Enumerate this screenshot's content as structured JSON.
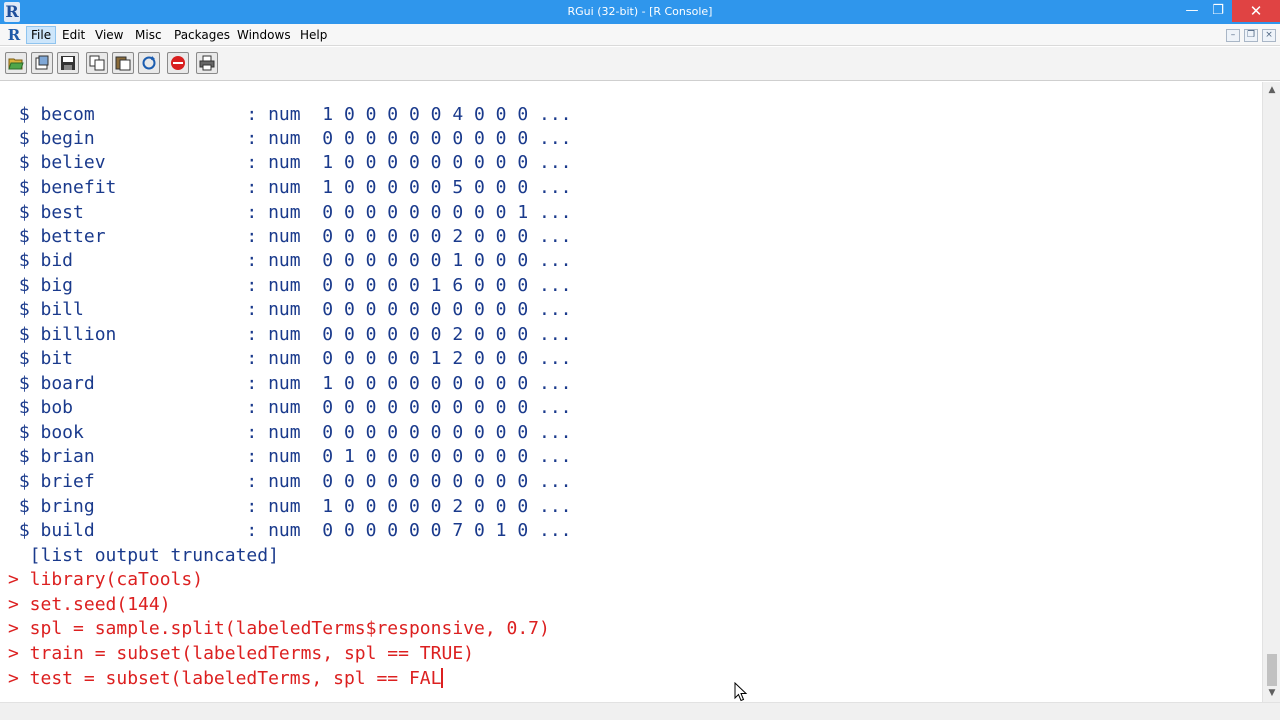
{
  "window": {
    "title": "RGui (32-bit) - [R Console]",
    "app_icon": "R"
  },
  "menu": {
    "r_icon": "R",
    "items": [
      "File",
      "Edit",
      "View",
      "Misc",
      "Packages",
      "Windows",
      "Help"
    ],
    "active_item": "File"
  },
  "toolbar": {
    "buttons": [
      "open-script-icon",
      "load-workspace-icon",
      "save-workspace-icon",
      "copy-icon",
      "copy-paste-icon",
      "refresh-icon",
      "stop-icon",
      "print-icon"
    ]
  },
  "console": {
    "lines": [
      " $ becom              : num  1 0 0 0 0 0 4 0 0 0 ...",
      " $ begin              : num  0 0 0 0 0 0 0 0 0 0 ...",
      " $ believ             : num  1 0 0 0 0 0 0 0 0 0 ...",
      " $ benefit            : num  1 0 0 0 0 0 5 0 0 0 ...",
      " $ best               : num  0 0 0 0 0 0 0 0 0 1 ...",
      " $ better             : num  0 0 0 0 0 0 2 0 0 0 ...",
      " $ bid                : num  0 0 0 0 0 0 1 0 0 0 ...",
      " $ big                : num  0 0 0 0 0 1 6 0 0 0 ...",
      " $ bill               : num  0 0 0 0 0 0 0 0 0 0 ...",
      " $ billion            : num  0 0 0 0 0 0 2 0 0 0 ...",
      " $ bit                : num  0 0 0 0 0 1 2 0 0 0 ...",
      " $ board              : num  1 0 0 0 0 0 0 0 0 0 ...",
      " $ bob                : num  0 0 0 0 0 0 0 0 0 0 ...",
      " $ book               : num  0 0 0 0 0 0 0 0 0 0 ...",
      " $ brian              : num  0 1 0 0 0 0 0 0 0 0 ...",
      " $ brief              : num  0 0 0 0 0 0 0 0 0 0 ...",
      " $ bring              : num  1 0 0 0 0 0 2 0 0 0 ...",
      " $ build              : num  0 0 0 0 0 0 7 0 1 0 ...",
      "  [list output truncated]"
    ],
    "commands": [
      "> library(caTools)",
      "> set.seed(144)",
      "> spl = sample.split(labeledTerms$responsive, 0.7)",
      "> train = subset(labeledTerms, spl == TRUE)"
    ],
    "current_input": "> test = subset(labeledTerms, spl == FAL",
    "output_color": "#1a3a8c",
    "command_color": "#dc2020"
  },
  "colors": {
    "titlebar": "#2f96ec",
    "close_button": "#e04343"
  }
}
